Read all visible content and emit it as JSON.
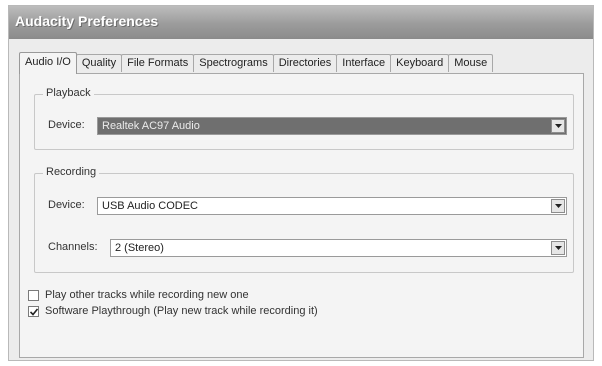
{
  "window": {
    "title": "Audacity Preferences"
  },
  "tabs": [
    {
      "label": "Audio I/O",
      "active": true
    },
    {
      "label": "Quality"
    },
    {
      "label": "File Formats"
    },
    {
      "label": "Spectrograms"
    },
    {
      "label": "Directories"
    },
    {
      "label": "Interface"
    },
    {
      "label": "Keyboard"
    },
    {
      "label": "Mouse"
    }
  ],
  "playback": {
    "title": "Playback",
    "device_label": "Device:",
    "device_value": "Realtek AC97 Audio"
  },
  "recording": {
    "title": "Recording",
    "device_label": "Device:",
    "device_value": "USB Audio CODEC",
    "channels_label": "Channels:",
    "channels_value": "2 (Stereo)"
  },
  "options": [
    {
      "label": "Play other tracks while recording new one",
      "checked": false
    },
    {
      "label": "Software Playthrough (Play new track while recording it)",
      "checked": true
    }
  ],
  "icons": {
    "dropdown": "chevron-down-icon",
    "check": "checkmark-icon"
  }
}
